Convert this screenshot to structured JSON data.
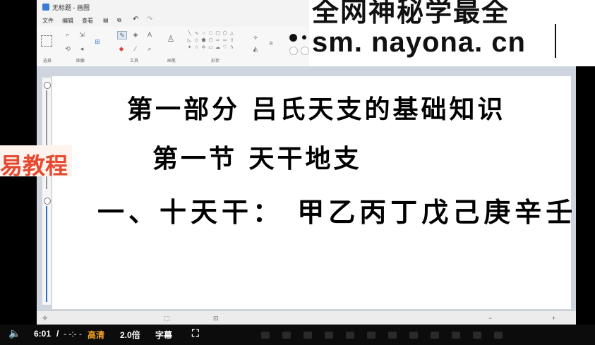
{
  "window": {
    "title": "无标题 - 画图"
  },
  "menu": {
    "file": "文件",
    "edit": "编辑",
    "view": "查看",
    "undo_icon": "undo-icon",
    "redo_icon": "redo-icon"
  },
  "ribbon_groups": {
    "select": "选择",
    "image": "图像",
    "tools": "工具",
    "brush": "画笔",
    "shapes": "形状"
  },
  "canvas_text": {
    "line1": "第一部分  吕氏天支的基础知识",
    "line2": "第一节  天干地支",
    "line3": "一、十天干： 甲乙丙丁戊己庚辛壬癸"
  },
  "watermark": {
    "line1": "全网神秘学最全",
    "line2": "sm. nayona. cn"
  },
  "side_label": "易教程",
  "player": {
    "time": "6:01",
    "separator": "/",
    "duration": "- -:- -",
    "quality": "高清",
    "speed": "2.0倍",
    "subtitles": "字幕"
  },
  "colors": {
    "accent": "#2a74c7",
    "quality_text": "#f5a623",
    "side_text": "#e5492f"
  }
}
